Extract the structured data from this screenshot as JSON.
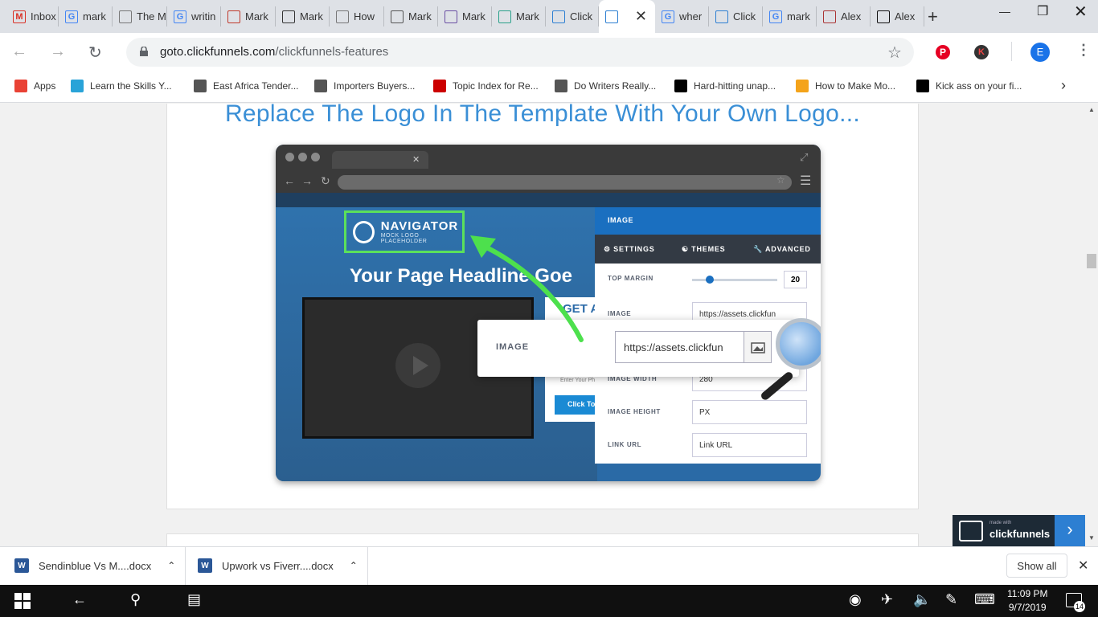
{
  "tabs": [
    {
      "title": "Inbox",
      "favicon": "gmail-icon",
      "color": "#d93025"
    },
    {
      "title": "mark",
      "favicon": "google-icon",
      "color": "#4285f4"
    },
    {
      "title": "The M",
      "favicon": "page-icon",
      "color": "#777777"
    },
    {
      "title": "writin",
      "favicon": "google-icon",
      "color": "#4285f4"
    },
    {
      "title": "Mark",
      "favicon": "target-icon",
      "color": "#c0392b"
    },
    {
      "title": "Mark",
      "favicon": "eye-icon",
      "color": "#333333"
    },
    {
      "title": "How",
      "favicon": "page-icon",
      "color": "#777777"
    },
    {
      "title": "Mark",
      "favicon": "globe-icon",
      "color": "#555555"
    },
    {
      "title": "Mark",
      "favicon": "m-icon",
      "color": "#6a4fa3"
    },
    {
      "title": "Mark",
      "favicon": "shield-icon",
      "color": "#2aa18a"
    },
    {
      "title": "Click",
      "favicon": "clickfunnels-icon",
      "color": "#2d7fd2"
    },
    {
      "title": "",
      "favicon": "clickfunnels-icon",
      "color": "#2d7fd2",
      "active": true
    },
    {
      "title": "wher",
      "favicon": "google-icon",
      "color": "#4285f4"
    },
    {
      "title": "Click",
      "favicon": "clickfunnels-icon",
      "color": "#2d7fd2"
    },
    {
      "title": "mark",
      "favicon": "google-icon",
      "color": "#4285f4"
    },
    {
      "title": "Alex",
      "favicon": "avatar-icon",
      "color": "#a33"
    },
    {
      "title": "Alex",
      "favicon": "dark-icon",
      "color": "#111111"
    }
  ],
  "toolbar": {
    "url_host": "goto.clickfunnels.com",
    "url_path": "/clickfunnels-features",
    "profile_initial": "E",
    "ext_initial": "K"
  },
  "bookmarks": [
    {
      "label": "Apps",
      "icon": "apps-grid-icon"
    },
    {
      "label": "Learn the Skills Y...",
      "icon": "graduation-icon"
    },
    {
      "label": "East Africa Tender...",
      "icon": "tender-icon"
    },
    {
      "label": "Importers Buyers...",
      "icon": "buyers-icon"
    },
    {
      "label": "Topic Index for Re...",
      "icon": "topic-icon"
    },
    {
      "label": "Do Writers Really...",
      "icon": "clock-icon"
    },
    {
      "label": "Hard-hitting unap...",
      "icon": "medium-icon"
    },
    {
      "label": "How to Make Mo...",
      "icon": "mp-icon"
    },
    {
      "label": "Kick ass on your fi...",
      "icon": "kick-icon"
    }
  ],
  "page": {
    "headline": "Replace The Logo In The Template With Your Own Logo..."
  },
  "mock": {
    "logo_title": "NAVIGATOR",
    "logo_sub": "MOCK LOGO PLACEHOLDER",
    "hero_headline": "Your Page Headline Goe",
    "form_head": "GET A",
    "form_input": "Enter Your Ph",
    "form_btn": "Click To",
    "panel": {
      "header": "IMAGE",
      "tabs": [
        "SETTINGS",
        "THEMES",
        "ADVANCED"
      ],
      "top_margin_label": "TOP MARGIN",
      "top_margin_value": "20",
      "top_margin_slider_fraction": 0.2,
      "image_label": "IMAGE",
      "image_value": "https://assets.clickfun",
      "width_label": "IMAGE WIDTH",
      "width_value": "280",
      "height_label": "IMAGE HEIGHT",
      "height_value": "PX",
      "link_label": "LINK URL",
      "link_value": "Link URL"
    },
    "zoom": {
      "label": "IMAGE",
      "value": "https://assets.clickfun"
    }
  },
  "badge": {
    "made_with": "made with",
    "name": "clickfunnels"
  },
  "downloads": [
    {
      "name": "Sendinblue Vs M....docx"
    },
    {
      "name": "Upwork vs Fiverr....docx"
    }
  ],
  "downloads_show_all": "Show all",
  "taskbar": {
    "time": "11:09 PM",
    "date": "9/7/2019",
    "notifications": "14"
  }
}
